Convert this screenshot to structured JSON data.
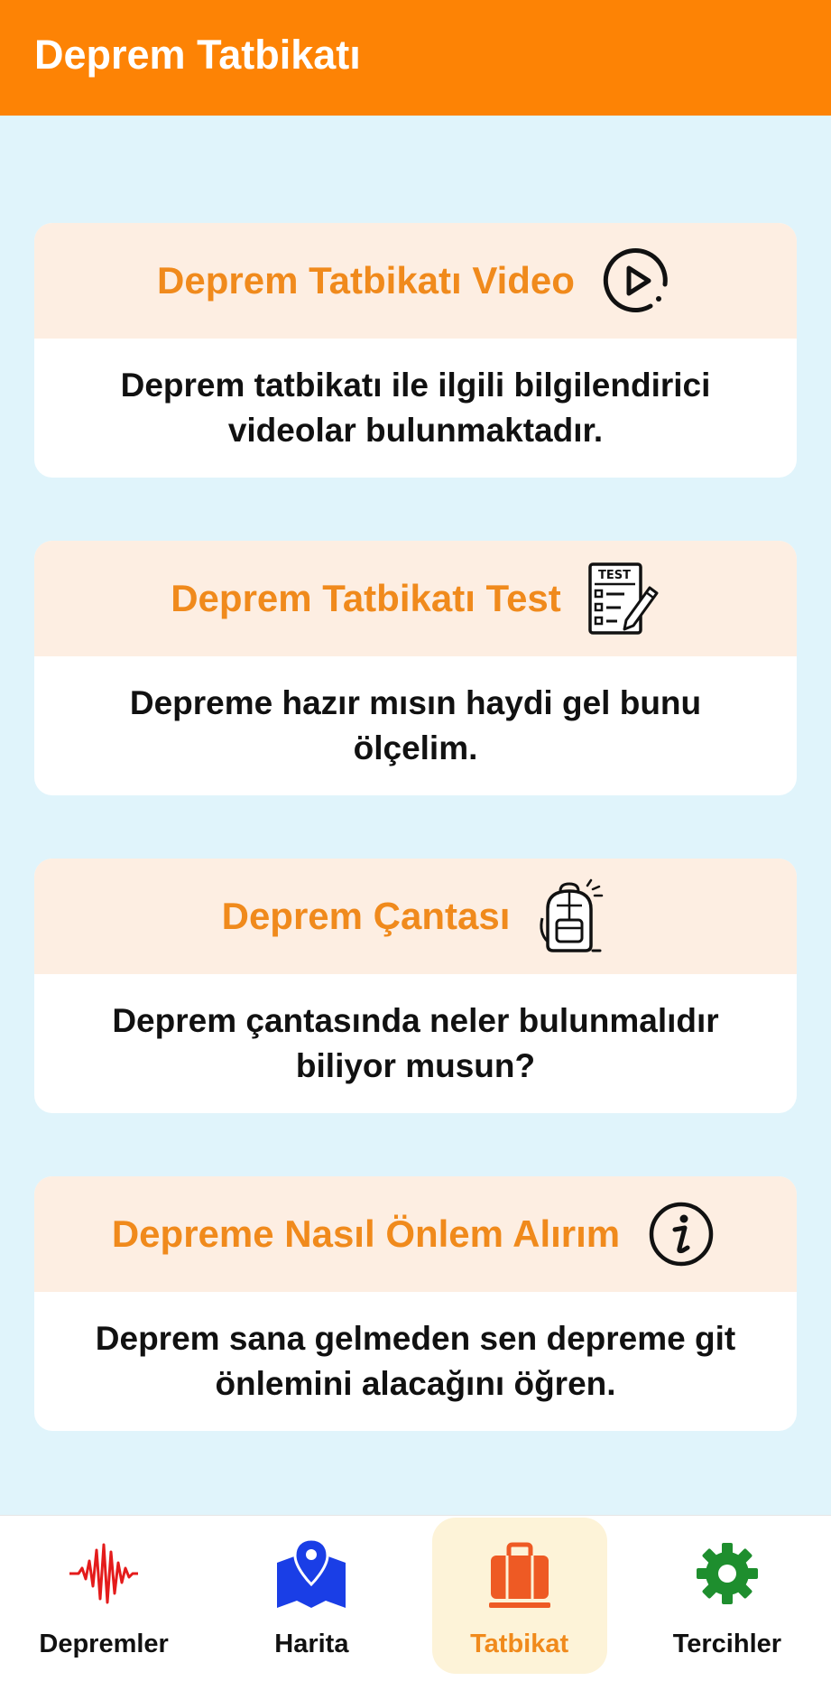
{
  "app_bar": {
    "title": "Deprem Tatbikatı"
  },
  "cards": [
    {
      "title": "Deprem Tatbikatı Video",
      "icon": "play-circle-icon",
      "description": "Deprem tatbikatı ile ilgili bilgilendirici videolar bulunmaktadır."
    },
    {
      "title": "Deprem Tatbikatı Test",
      "icon": "test-checklist-icon",
      "description": "Depreme hazır mısın haydi gel bunu ölçelim."
    },
    {
      "title": "Deprem Çantası",
      "icon": "backpack-icon",
      "description": "Deprem çantasında neler bulunmalıdır biliyor musun?"
    },
    {
      "title": "Depreme Nasıl Önlem Alırım",
      "icon": "info-circle-icon",
      "description": "Deprem sana gelmeden sen depreme git önlemini alacağını öğren."
    }
  ],
  "bottom_nav": {
    "items": [
      {
        "label": "Depremler",
        "icon": "seismic-wave-icon"
      },
      {
        "label": "Harita",
        "icon": "map-pin-icon"
      },
      {
        "label": "Tatbikat",
        "icon": "briefcase-icon"
      },
      {
        "label": "Tercihler",
        "icon": "gear-icon"
      }
    ],
    "active_label": "Tatbikat"
  },
  "colors": {
    "primary": "#fd8305",
    "background": "#e0f4fb",
    "card_header": "#fdeee2",
    "accent_text": "#f08a1c",
    "active_nav_bg": "#fdf3d8",
    "seismic_red": "#e41b1b",
    "map_blue": "#1a3ee6",
    "briefcase_orange": "#ee5a24",
    "gear_green": "#1e8e2e"
  }
}
